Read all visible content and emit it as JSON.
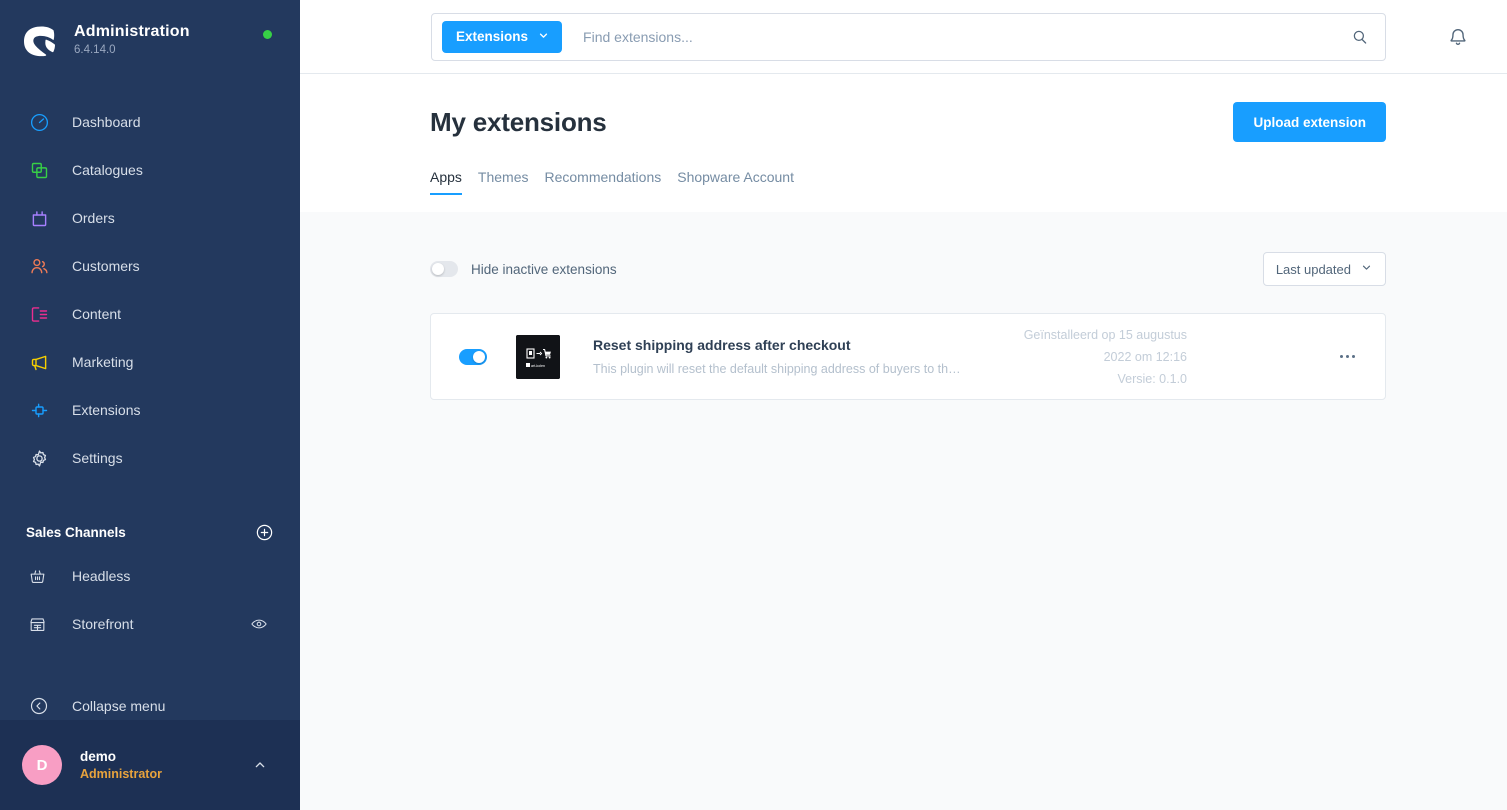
{
  "sidebar": {
    "brand": {
      "title": "Administration",
      "version": "6.4.14.0",
      "status_icon": "green-status-dot",
      "logo_icon": "shopware-logo"
    },
    "items": [
      {
        "label": "Dashboard",
        "icon": "dashboard-gauge-icon",
        "color": "#189eff"
      },
      {
        "label": "Catalogues",
        "icon": "catalogues-copy-icon",
        "color": "#37d046"
      },
      {
        "label": "Orders",
        "icon": "orders-bag-icon",
        "color": "#a780ff"
      },
      {
        "label": "Customers",
        "icon": "customers-people-icon",
        "color": "#ef7b56"
      },
      {
        "label": "Content",
        "icon": "content-layout-icon",
        "color": "#ec2e8f"
      },
      {
        "label": "Marketing",
        "icon": "marketing-megaphone-icon",
        "color": "#f7d000"
      },
      {
        "label": "Extensions",
        "icon": "extensions-plug-icon",
        "color": "#189eff"
      },
      {
        "label": "Settings",
        "icon": "settings-gear-icon",
        "color": "#d8dfe9"
      }
    ],
    "sales_channels": {
      "title": "Sales Channels",
      "add_icon": "plus-circle-icon",
      "items": [
        {
          "label": "Headless",
          "icon": "headless-basket-icon",
          "has_eye": false
        },
        {
          "label": "Storefront",
          "icon": "storefront-shop-icon",
          "has_eye": true,
          "eye_icon": "eye-icon"
        }
      ]
    },
    "collapse": {
      "label": "Collapse menu",
      "icon": "collapse-left-icon"
    },
    "user": {
      "initial": "D",
      "name": "demo",
      "role": "Administrator",
      "caret_icon": "chevron-up-icon"
    }
  },
  "topbar": {
    "scope_label": "Extensions",
    "scope_caret_icon": "chevron-down-icon",
    "search_placeholder": "Find extensions...",
    "search_value": "",
    "search_icon": "search-icon",
    "bell_icon": "bell-icon"
  },
  "page": {
    "title": "My extensions",
    "upload_label": "Upload extension",
    "tabs": [
      {
        "label": "Apps",
        "active": true
      },
      {
        "label": "Themes",
        "active": false
      },
      {
        "label": "Recommendations",
        "active": false
      },
      {
        "label": "Shopware Account",
        "active": false
      }
    ]
  },
  "controls": {
    "hide_inactive_label": "Hide inactive extensions",
    "hide_inactive_on": false,
    "sort_label": "Last updated",
    "sort_caret_icon": "chevron-down-icon"
  },
  "extensions": [
    {
      "active": true,
      "thumb_icon": "plugin-thumbnail",
      "name": "Reset shipping address after checkout",
      "description": "This plugin will reset the default shipping address of buyers to the defa…",
      "installed_line1": "Geïnstalleerd op 15 augustus",
      "installed_line2": "2022 om 12:16",
      "version_line": "Versie: 0.1.0",
      "menu_icon": "context-menu-icon"
    }
  ],
  "colors": {
    "sidebar_bg": "#23395e",
    "user_bar_bg": "#1d3054",
    "accent": "#189eff",
    "content_bg": "#f9fafb",
    "avatar": "#f89ec4",
    "role": "#e8a33d",
    "status_dot": "#37d046"
  }
}
